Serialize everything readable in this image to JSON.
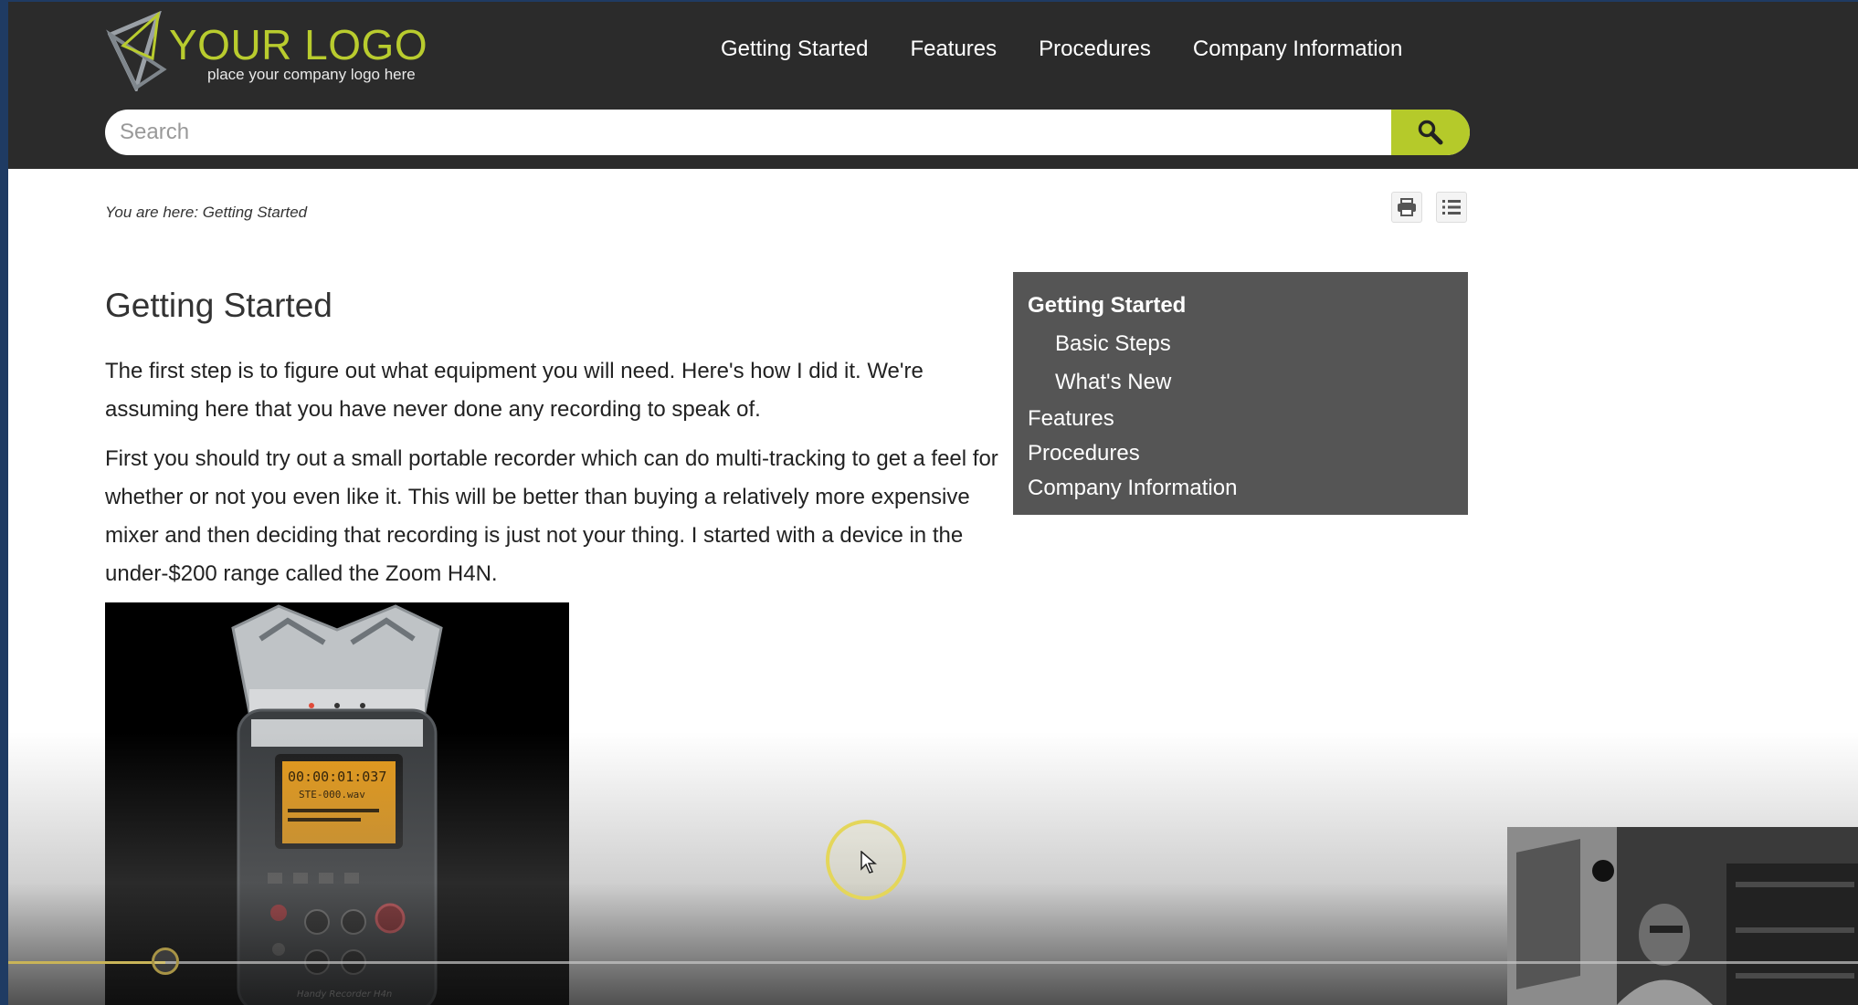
{
  "logo": {
    "title": "YOUR LOGO",
    "tagline": "place your company logo here",
    "accent_color": "#b9cc2e"
  },
  "nav": {
    "items": [
      {
        "label": "Getting Started"
      },
      {
        "label": "Features"
      },
      {
        "label": "Procedures"
      },
      {
        "label": "Company Information"
      }
    ]
  },
  "search": {
    "placeholder": "Search",
    "icon": "search-icon",
    "button_color": "#b5ca2a"
  },
  "breadcrumb": {
    "text": "You are here: Getting Started"
  },
  "toolbar": {
    "print_icon": "print-icon",
    "toc_icon": "list-icon"
  },
  "main": {
    "title": "Getting Started",
    "paragraphs": [
      "The first step is to figure out what equipment you will need. Here's how I did it. We're assuming here that you have never done any recording to speak of.",
      "First you should try out a small portable recorder which can do multi-tracking to get a feel for whether or not you even like it. This will be better than buying a relatively more expensive mixer and then deciding that recording is just not your thing. I started with a device in the under-$200 range called the Zoom H4N."
    ],
    "recorder_display": {
      "time": "00:00:01:037",
      "file": "STE-000.wav",
      "brand_text": "Handy Recorder H4n"
    }
  },
  "toc": {
    "items": [
      {
        "label": "Getting Started"
      },
      {
        "label": "Basic Steps"
      },
      {
        "label": "What's New"
      },
      {
        "label": "Features"
      },
      {
        "label": "Procedures"
      },
      {
        "label": "Company Information"
      }
    ],
    "background": "#555555"
  },
  "video": {
    "progress_fraction": 0.085,
    "progress_color": "#c9b458"
  }
}
